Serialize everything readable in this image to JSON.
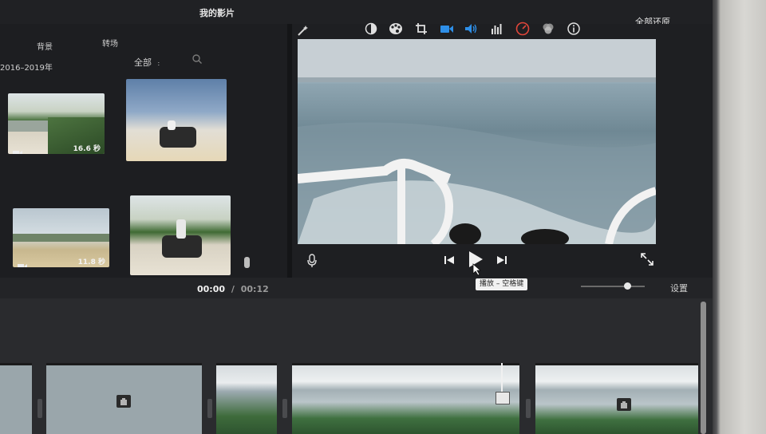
{
  "app": {
    "project_title": "我的影片",
    "revert_all_label": "全部还原"
  },
  "browser": {
    "tabs": [
      {
        "label": "背景"
      },
      {
        "label": "转场"
      }
    ],
    "date_range": "2016–2019年",
    "filter_label": "全部",
    "filter_caret": "⌃",
    "clips": [
      {
        "duration": "16.6 秒",
        "type_icon": "video-camera-icon"
      },
      {
        "duration": "11.8 秒",
        "type_icon": "video-camera-icon"
      }
    ]
  },
  "toolbar": {
    "tools": [
      {
        "name": "magic-wand-icon",
        "glyph": "✦"
      },
      {
        "name": "color-balance-icon",
        "glyph": "◐"
      },
      {
        "name": "color-correction-icon",
        "glyph": "🎨"
      },
      {
        "name": "crop-icon",
        "glyph": "⌗"
      },
      {
        "name": "stabilization-icon",
        "glyph": "▣"
      },
      {
        "name": "volume-icon",
        "glyph": "🔊"
      },
      {
        "name": "equalizer-icon",
        "glyph": "▇"
      },
      {
        "name": "speed-icon",
        "glyph": "◔"
      },
      {
        "name": "filter-icon",
        "glyph": "◉"
      },
      {
        "name": "info-icon",
        "glyph": "ⓘ"
      }
    ]
  },
  "viewer": {
    "playback": {
      "prev_icon": "⏮",
      "play_icon": "▶",
      "next_icon": "⏭",
      "fullscreen_icon": "⤡",
      "mic_icon": "🎙"
    },
    "tooltip": "播放 – 空格键"
  },
  "timeline": {
    "current_time": "00:00",
    "separator": "/",
    "total_time": "00:12",
    "settings_label": "设置",
    "zoom_level": 0.72
  },
  "colors": {
    "accent_blue": "#2e8fe8",
    "speed_red": "#e0463a"
  }
}
